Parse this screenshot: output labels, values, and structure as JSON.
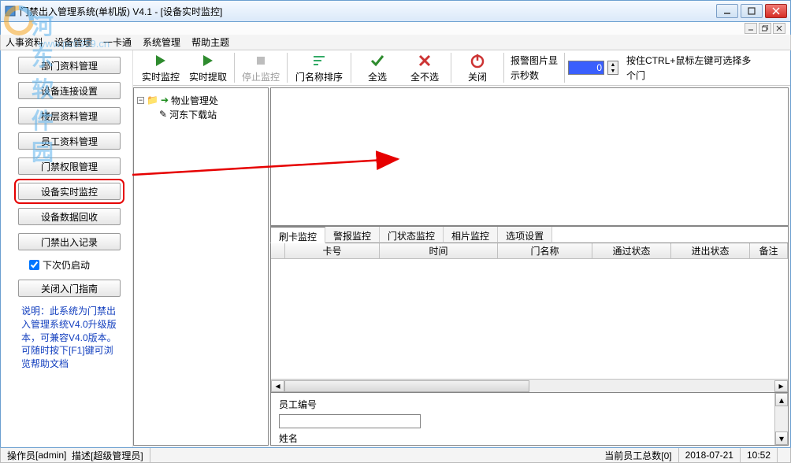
{
  "window": {
    "title": "门禁出入管理系统(单机版)  V4.1 - [设备实时监控]"
  },
  "menu": {
    "items": [
      "人事资料",
      "设备管理",
      "一卡通",
      "系统管理",
      "帮助主题"
    ]
  },
  "watermark": {
    "line1": "河东软件园",
    "line2": "www.pc0359.cn"
  },
  "sidebar": {
    "buttons": {
      "b0": "部门资料管理",
      "b1": "设备连接设置",
      "b2": "楼层资料管理",
      "b3": "员工资料管理",
      "b4": "门禁权限管理",
      "b5": "设备实时监控",
      "b6": "设备数据回收",
      "b7": "门禁出入记录",
      "b8": "关闭入门指南"
    },
    "checkbox": "下次仍启动",
    "help": "说明：此系统为门禁出入管理系统V4.0升级版本，可兼容V4.0版本。可随时按下[F1]键可浏览帮助文档"
  },
  "toolbar": {
    "realtime": "实时监控",
    "extract": "实时提取",
    "stop": "停止监控",
    "sort": "门名称排序",
    "selall": "全选",
    "selnone": "全不选",
    "close": "关闭",
    "alarm_label1": "报警图片显",
    "alarm_label2": "示秒数",
    "num_value": "0",
    "hint1": "按住CTRL+鼠标左键可选择多",
    "hint2": "个门"
  },
  "tree": {
    "root": "物业管理处",
    "child": "河东下载站"
  },
  "tabs": {
    "t0": "刷卡监控",
    "t1": "警报监控",
    "t2": "门状态监控",
    "t3": "相片监控",
    "t4": "选项设置"
  },
  "grid": {
    "cols": {
      "c0": "卡号",
      "c1": "时间",
      "c2": "门名称",
      "c3": "通过状态",
      "c4": "进出状态",
      "c5": "备注"
    }
  },
  "detail": {
    "emp_no": "员工编号",
    "name": "姓名"
  },
  "status": {
    "operator_label": "操作员",
    "operator_value": "[admin]",
    "desc_label": "描述",
    "desc_value": "[超级管理员]",
    "count": "当前员工总数[0]",
    "date": "2018-07-21",
    "time": "10:52"
  }
}
